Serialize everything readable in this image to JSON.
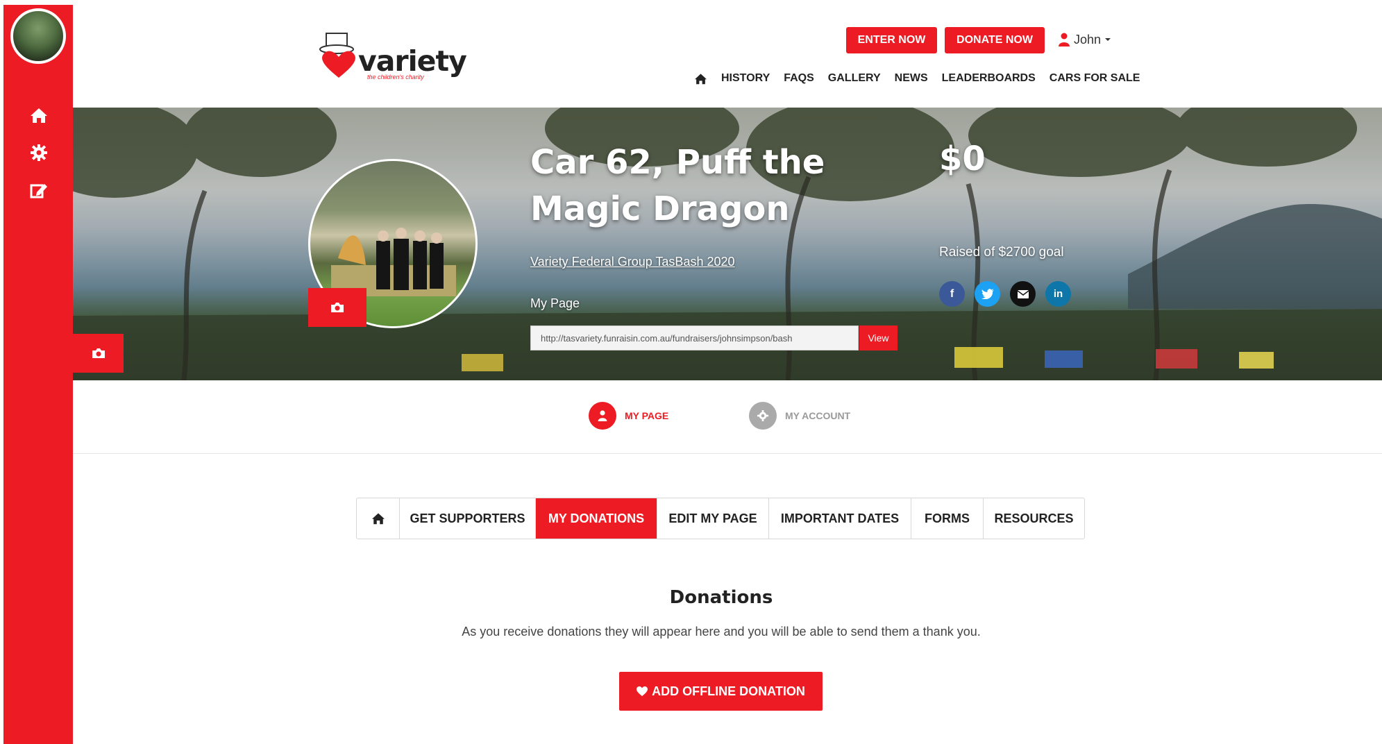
{
  "header": {
    "logo_text": "variety",
    "logo_tagline": "the children's charity",
    "enter_now_label": "ENTER NOW",
    "donate_now_label": "DONATE NOW",
    "user_name": "John",
    "nav": [
      "HISTORY",
      "FAQS",
      "GALLERY",
      "NEWS",
      "LEADERBOARDS",
      "CARS FOR SALE"
    ]
  },
  "hero": {
    "title": "Car 62, Puff the Magic Dragon",
    "event_link": "Variety Federal Group TasBash 2020",
    "my_page_label": "My Page",
    "page_url": "http://tasvariety.funraisin.com.au/fundraisers/johnsimpson/bash",
    "view_label": "View",
    "amount_raised": "$0",
    "goal_text": "Raised of $2700 goal"
  },
  "switcher": {
    "my_page": "MY PAGE",
    "my_account": "MY ACCOUNT"
  },
  "tabs": [
    "GET SUPPORTERS",
    "MY DONATIONS",
    "EDIT MY PAGE",
    "IMPORTANT DATES",
    "FORMS",
    "RESOURCES"
  ],
  "active_tab": "MY DONATIONS",
  "donations": {
    "title": "Donations",
    "description": "As you receive donations they will appear here and you will be able to send them a thank you.",
    "add_button_label": "ADD OFFLINE DONATION"
  },
  "colors": {
    "accent": "#ed1c24",
    "facebook": "#3b5998",
    "twitter": "#1da1f2",
    "email": "#111111",
    "linkedin": "#0e76a8"
  },
  "icons": [
    "home-icon",
    "gear-icon",
    "edit-icon",
    "camera-icon",
    "user-icon",
    "heart-icon",
    "facebook-icon",
    "twitter-icon",
    "email-icon",
    "linkedin-icon"
  ]
}
